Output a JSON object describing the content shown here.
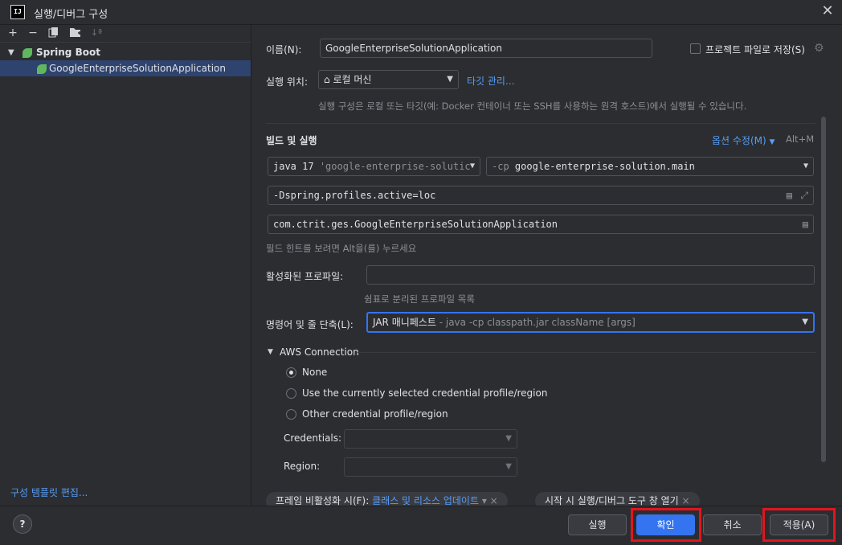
{
  "window": {
    "title": "실행/디버그 구성",
    "app_icon": "IJ"
  },
  "toolbar": {
    "add": "+",
    "remove": "−",
    "copy_icon": "copy-icon",
    "folder_icon": "folder-add-icon",
    "sort_icon": "sort-icon"
  },
  "tree": {
    "group": "Spring Boot",
    "item": "GoogleEnterpriseSolutionApplication"
  },
  "left_footer": {
    "edit_templates": "구성 템플릿 편집..."
  },
  "form": {
    "name_label": "이름(N):",
    "name_value": "GoogleEnterpriseSolutionApplication",
    "store_as_project_file": "프로젝트 파일로 저장(S)",
    "run_on_label": "실행 위치:",
    "run_on_value": "로컬 머신",
    "manage_targets": "타깃 관리...",
    "run_on_hint": "실행 구성은 로컬 또는 타깃(예: Docker 컨테이너 또는 SSH를 사용하는 원격 호스트)에서 실행될 수 있습니다.",
    "build_run_title": "빌드 및 실행",
    "modify_options": "옵션 수정(M)",
    "modify_shortcut": "Alt+M",
    "jre_value": "java 17",
    "jre_hint": "'google-enterprise-solutic",
    "classpath_prefix": "-cp",
    "classpath_value": "google-enterprise-solution.main",
    "vm_options": "-Dspring.profiles.active=loc",
    "main_class": "com.ctrit.ges.GoogleEnterpriseSolutionApplication",
    "field_hint": "필드 힌트를 보려면 Alt을(를) 누르세요",
    "active_profiles_label": "활성화된 프로파일:",
    "active_profiles_hint": "쉼표로 분리된 프로파일 목록",
    "shorten_label": "명령어 및 줄 단축(L):",
    "shorten_value": "JAR 매니페스트",
    "shorten_detail": "- java -cp classpath.jar className [args]",
    "aws_section": "AWS Connection",
    "aws_options": [
      "None",
      "Use the currently selected credential profile/region",
      "Other credential profile/region"
    ],
    "aws_selected": 0,
    "credentials_label": "Credentials:",
    "region_label": "Region:",
    "chip1_label": "프레임 비활성화 시(F):",
    "chip1_value": "클래스 및 리소스 업데이트",
    "chip2_label": "시작 시 실행/디버그 도구 창 열기"
  },
  "buttons": {
    "run": "실행",
    "ok": "확인",
    "cancel": "취소",
    "apply": "적용(A)",
    "help": "?"
  },
  "colors": {
    "accent": "#3574f0",
    "link": "#589df6",
    "highlight_box": "#e0161e",
    "selection": "#2e436e"
  }
}
